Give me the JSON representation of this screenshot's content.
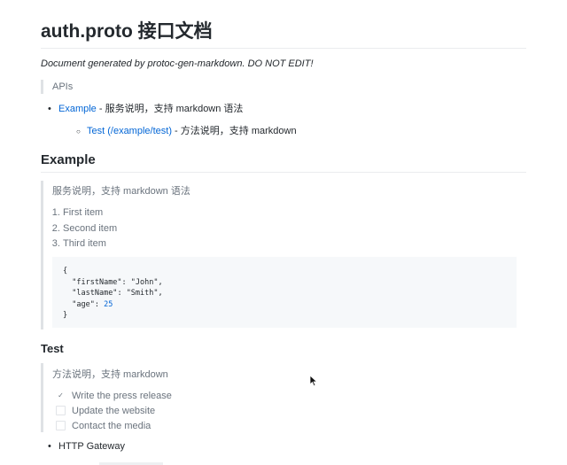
{
  "title": "auth.proto 接口文档",
  "note": "Document generated by protoc-gen-markdown. DO NOT EDIT!",
  "apis_label": "APIs",
  "toc": {
    "service_link": "Example",
    "service_desc": " - 服务说明，支持 markdown 语法",
    "method_link": "Test (/example/test)",
    "method_desc": " - 方法说明，支持 markdown"
  },
  "service": {
    "heading": "Example",
    "description": "服务说明，支持 markdown 语法",
    "list": [
      "First item",
      "Second item",
      "Third item"
    ],
    "code": {
      "open": "{",
      "line1_key": "\"firstName\"",
      "line1_val": "\"John\"",
      "line2_key": "\"lastName\"",
      "line2_val": "\"Smith\"",
      "line3_key": "\"age\"",
      "line3_val": "25",
      "close": "}"
    }
  },
  "method": {
    "heading": "Test",
    "description": "方法说明，支持 markdown",
    "tasks": [
      {
        "label": "Write the press release",
        "checked": true,
        "mark": "✓"
      },
      {
        "label": "Update the website",
        "checked": false,
        "mark": ""
      },
      {
        "label": "Contact the media",
        "checked": false,
        "mark": ""
      }
    ]
  },
  "gateway_item": "HTTP Gateway",
  "colors": {
    "link": "#0366d6",
    "muted": "#6a737d",
    "border": "#dfe2e5",
    "code_bg": "#f6f8fa"
  }
}
